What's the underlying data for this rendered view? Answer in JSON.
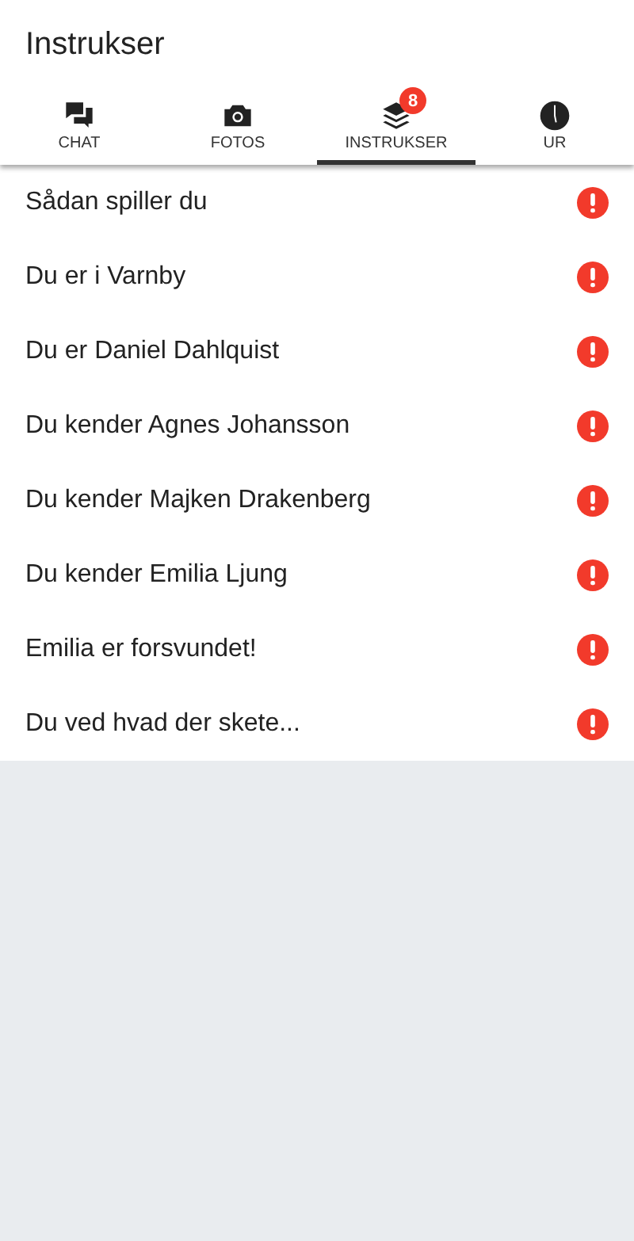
{
  "header": {
    "title": "Instrukser"
  },
  "tabs": [
    {
      "label": "CHAT",
      "kind": "chat",
      "selected": false
    },
    {
      "label": "FOTOS",
      "kind": "camera",
      "selected": false
    },
    {
      "label": "INSTRUKSER",
      "kind": "layers",
      "selected": true,
      "badge": "8"
    },
    {
      "label": "UR",
      "kind": "clock",
      "selected": false
    }
  ],
  "items": [
    {
      "text": "Sådan spiller du",
      "unread": true
    },
    {
      "text": "Du er i Varnby",
      "unread": true
    },
    {
      "text": "Du er Daniel Dahlquist",
      "unread": true
    },
    {
      "text": "Du kender Agnes Johansson",
      "unread": true
    },
    {
      "text": "Du kender Majken Drakenberg",
      "unread": true
    },
    {
      "text": "Du kender Emilia Ljung",
      "unread": true
    },
    {
      "text": "Emilia er forsvundet!",
      "unread": true
    },
    {
      "text": "Du ved hvad der skete...",
      "unread": true
    }
  ]
}
